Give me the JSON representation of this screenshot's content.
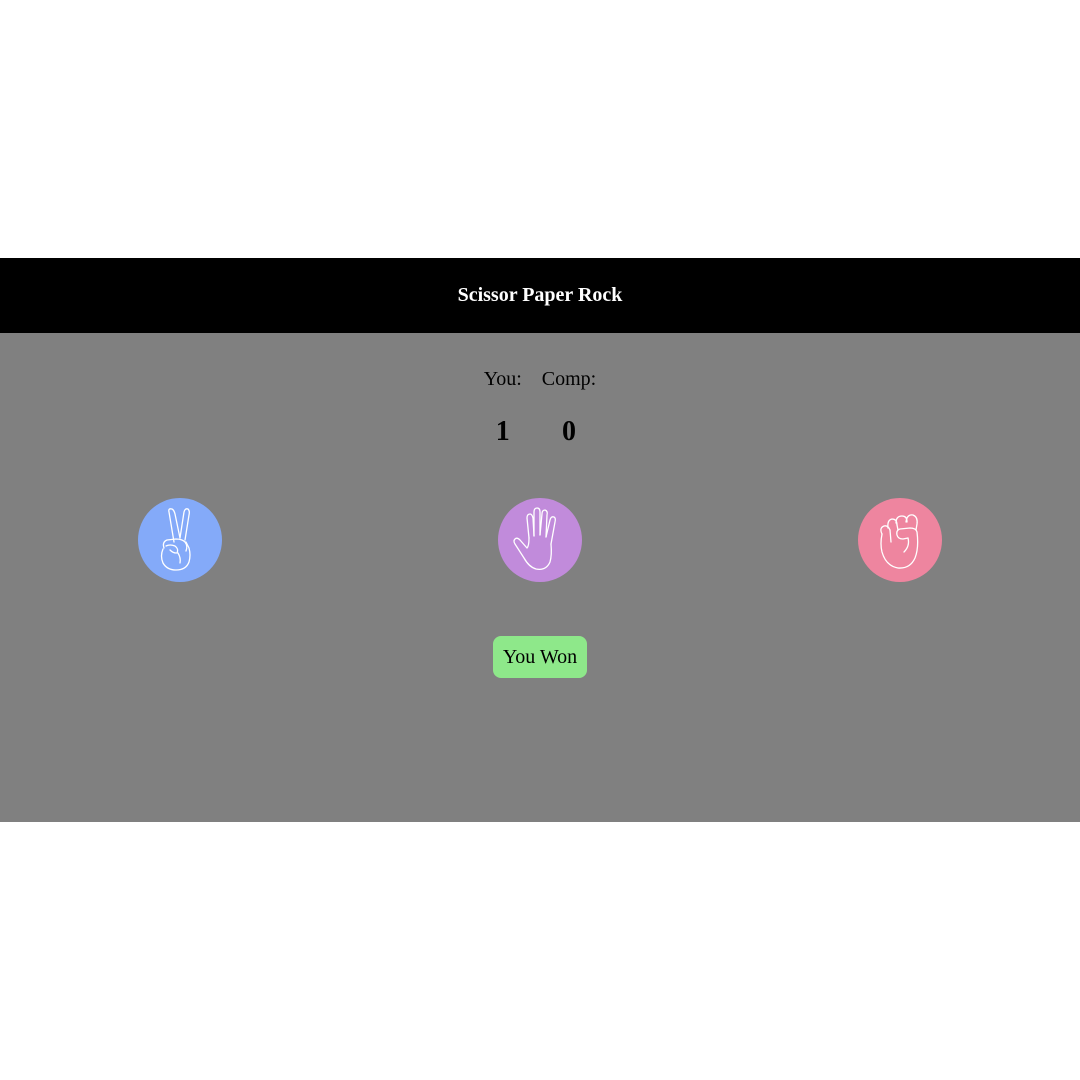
{
  "header": {
    "title": "Scissor Paper Rock"
  },
  "scores": {
    "you_label": "You:",
    "comp_label": "Comp:",
    "you_value": "1",
    "comp_value": "0"
  },
  "choices": [
    {
      "name": "scissor",
      "icon": "scissor-hand-icon",
      "color": "#84aaf9"
    },
    {
      "name": "paper",
      "icon": "paper-hand-icon",
      "color": "#c18bdb"
    },
    {
      "name": "rock",
      "icon": "rock-fist-icon",
      "color": "#ee859f"
    }
  ],
  "result": {
    "text": "You Won",
    "color": "#8ee88a"
  },
  "colors": {
    "header_bg": "#000000",
    "board_bg": "#808080"
  }
}
